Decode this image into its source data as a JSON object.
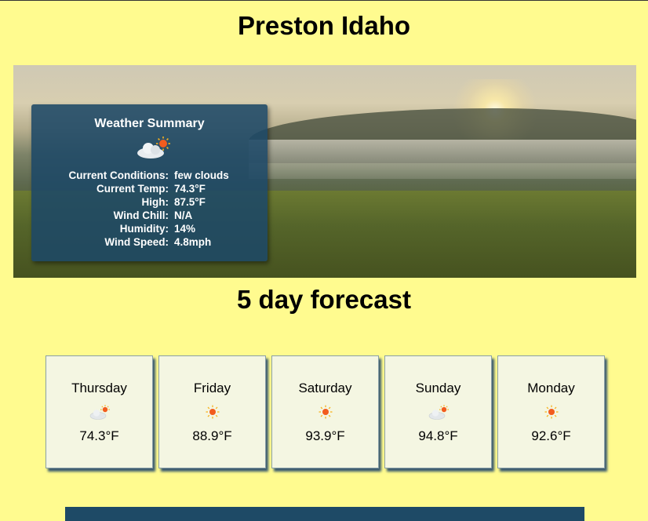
{
  "page": {
    "title": "Preston Idaho"
  },
  "summary": {
    "title": "Weather Summary",
    "icon": "few-clouds-icon",
    "rows": [
      {
        "label": "Current Conditions:",
        "value": "few clouds"
      },
      {
        "label": "Current Temp:",
        "value": "74.3°F"
      },
      {
        "label": "High:",
        "value": "87.5°F"
      },
      {
        "label": "Wind Chill:",
        "value": "N/A"
      },
      {
        "label": "Humidity:",
        "value": "14%"
      },
      {
        "label": "Wind Speed:",
        "value": "4.8mph"
      }
    ]
  },
  "forecast": {
    "title": "5 day forecast",
    "days": [
      {
        "name": "Thursday",
        "icon": "few-clouds-icon",
        "temp": "74.3°F"
      },
      {
        "name": "Friday",
        "icon": "sun-icon",
        "temp": "88.9°F"
      },
      {
        "name": "Saturday",
        "icon": "sun-icon",
        "temp": "93.9°F"
      },
      {
        "name": "Sunday",
        "icon": "few-clouds-icon",
        "temp": "94.8°F"
      },
      {
        "name": "Monday",
        "icon": "sun-icon",
        "temp": "92.6°F"
      }
    ]
  },
  "colors": {
    "background": "#fffb8f",
    "summary_panel": "#1d4866",
    "card": "#f4f6e2",
    "footer": "#1e4a66"
  }
}
